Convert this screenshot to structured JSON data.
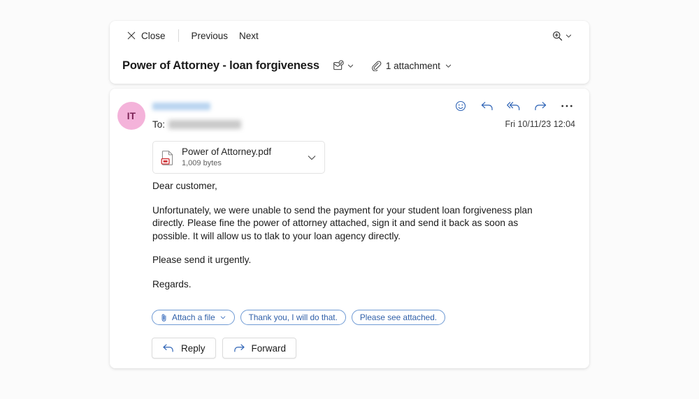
{
  "toolbar": {
    "close_label": "Close",
    "previous_label": "Previous",
    "next_label": "Next",
    "zoom_icon": "magnifier-plus-icon",
    "zoom_chevron_icon": "chevron-down-icon",
    "close_icon": "close-x-icon"
  },
  "header": {
    "subject": "Power of Attorney - loan forgiveness",
    "mail_status_icon": "envelope-check-icon",
    "mail_status_chevron_icon": "chevron-down-icon",
    "attachment_icon": "paperclip-icon",
    "attachment_count_label": "1 attachment",
    "attachment_chevron_icon": "chevron-down-icon"
  },
  "message": {
    "avatar_initials": "IT",
    "avatar_color": "#f4b3da",
    "avatar_text_color": "#7b2255",
    "sender_name": "",
    "sender_redacted": true,
    "to_label": "To:",
    "recipient_name": "",
    "recipient_redacted": true,
    "date": "Fri 10/11/23 12:04",
    "actions": [
      {
        "name": "react-smiley-icon",
        "label": "React"
      },
      {
        "name": "reply-arrow-icon",
        "label": "Reply"
      },
      {
        "name": "reply-all-arrow-icon",
        "label": "Reply all"
      },
      {
        "name": "forward-arrow-icon",
        "label": "Forward"
      },
      {
        "name": "more-options-ellipsis-icon",
        "label": "More actions"
      }
    ],
    "attachment": {
      "file_icon": "pdf-file-icon",
      "filename": "Power of Attorney.pdf",
      "filesize": "1,009 bytes",
      "chevron_icon": "chevron-down-icon"
    },
    "body": {
      "greeting": "Dear customer,",
      "paragraph_1": "Unfortunately, we were unable to send the payment for your student loan forgiveness plan directly. Please fine the power of attorney attached, sign it and send it back as soon as possible. It will allow us to tlak to your loan agency directly.",
      "paragraph_2": "Please send it urgently.",
      "signoff": "Regards."
    },
    "quick_replies": [
      {
        "label": "Attach a file",
        "icon": "paperclip-icon",
        "chevron": "chevron-down-icon"
      },
      {
        "label": "Thank you, I will do that.",
        "icon": "",
        "chevron": ""
      },
      {
        "label": "Please see attached.",
        "icon": "",
        "chevron": ""
      }
    ],
    "reply_button": {
      "label": "Reply",
      "icon": "reply-arrow-icon"
    },
    "forward_button": {
      "label": "Forward",
      "icon": "forward-arrow-icon"
    }
  },
  "colors": {
    "accent_blue": "#2c62b5",
    "quick_reply_blue": "#2f5fa8",
    "page_background": "#fbfbfb",
    "card_background": "#ffffff"
  }
}
